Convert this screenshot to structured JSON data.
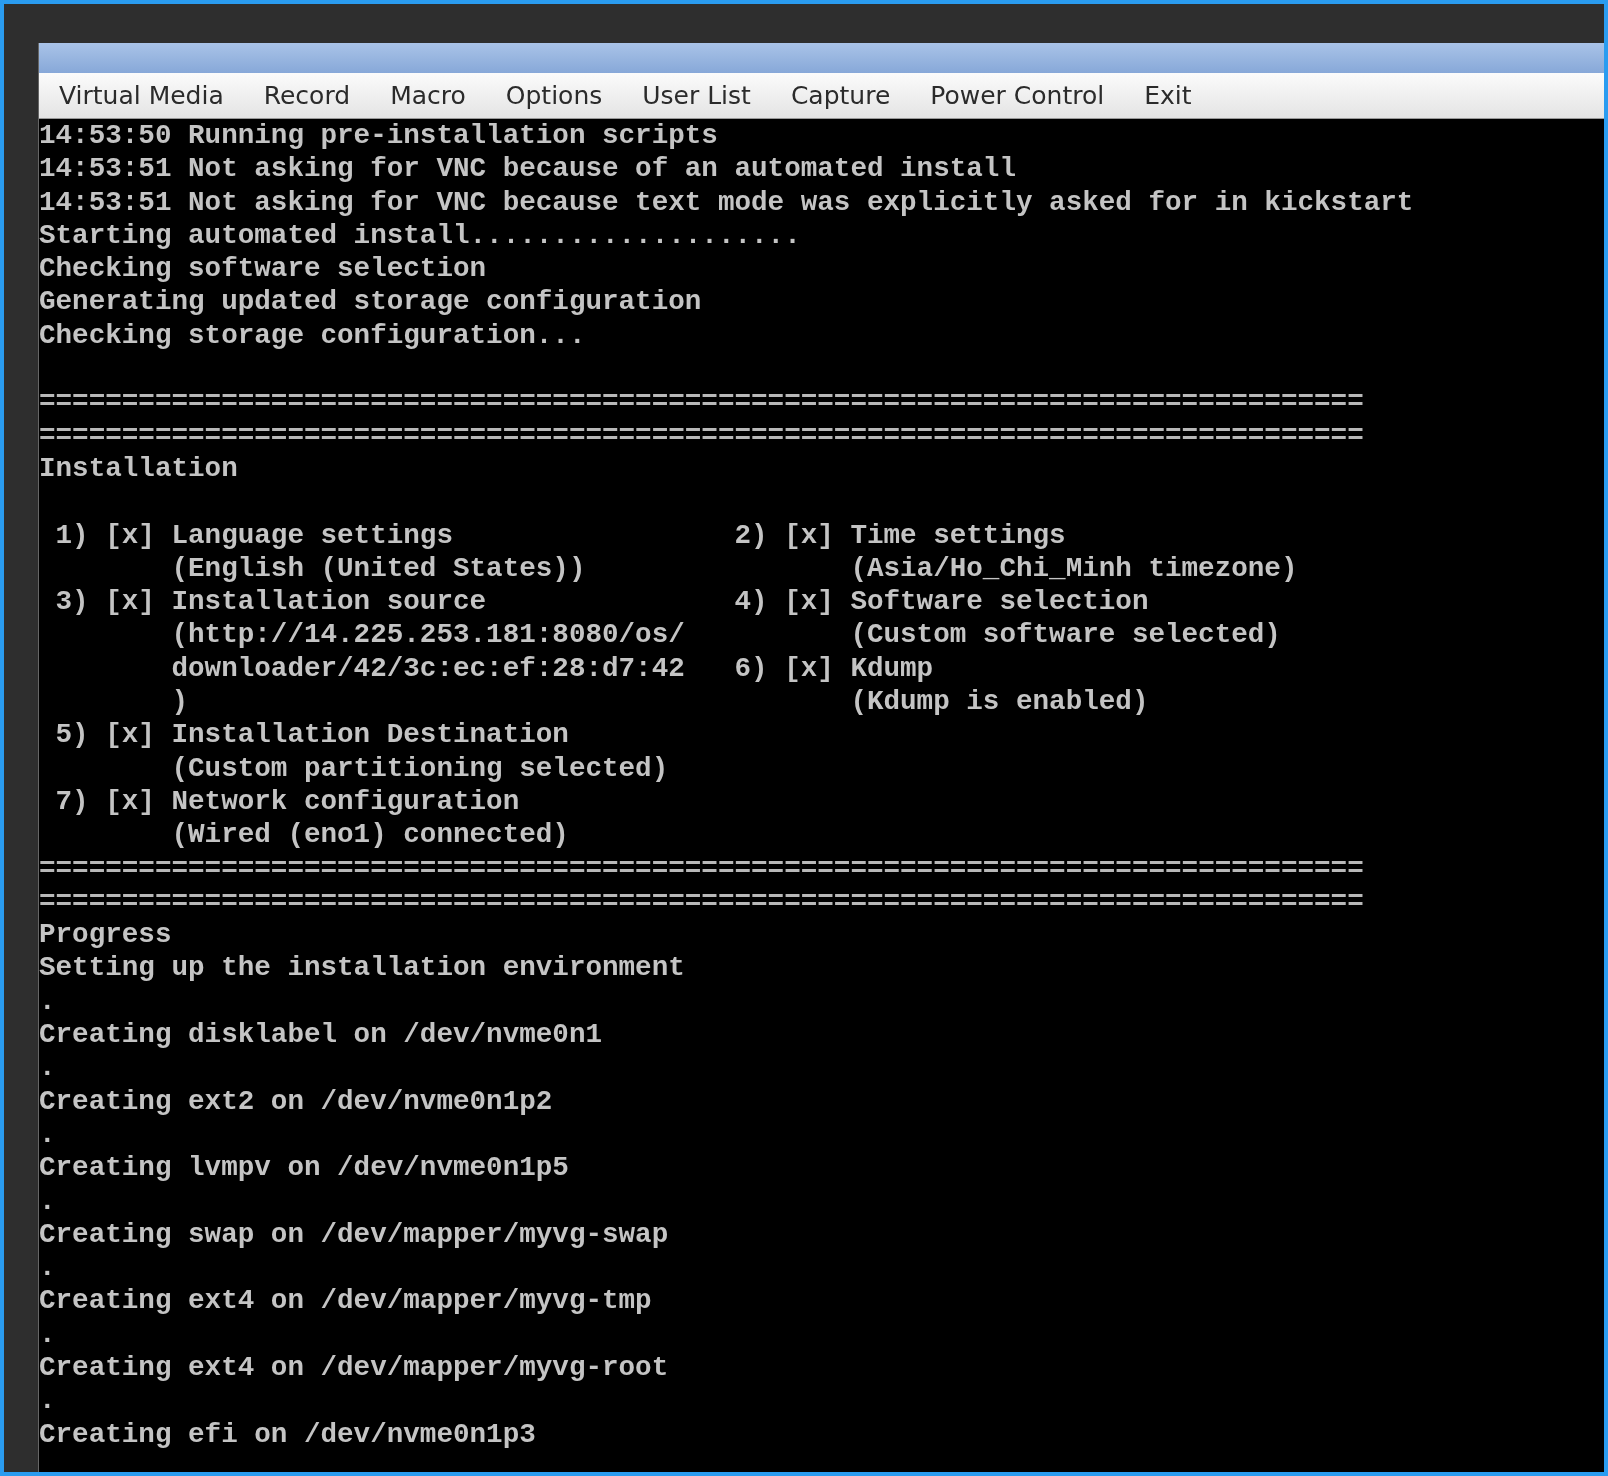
{
  "menu": [
    "Virtual Media",
    "Record",
    "Macro",
    "Options",
    "User List",
    "Capture",
    "Power Control",
    "Exit"
  ],
  "console": [
    {
      "kind": "text",
      "text": "14:53:50 Running pre-installation scripts"
    },
    {
      "kind": "text",
      "text": "14:53:51 Not asking for VNC because of an automated install"
    },
    {
      "kind": "text",
      "text": "14:53:51 Not asking for VNC because text mode was explicitly asked for in kickstart"
    },
    {
      "kind": "text",
      "text": "Starting automated install...................."
    },
    {
      "kind": "text",
      "text": "Checking software selection"
    },
    {
      "kind": "text",
      "text": "Generating updated storage configuration"
    },
    {
      "kind": "text",
      "text": "Checking storage configuration..."
    },
    {
      "kind": "blank"
    },
    {
      "kind": "separator",
      "text": "================================================================================"
    },
    {
      "kind": "separator",
      "text": "================================================================================"
    },
    {
      "kind": "text",
      "text": "Installation"
    },
    {
      "kind": "blank"
    },
    {
      "kind": "columns",
      "left": " 1) [x] Language settings",
      "right": "2) [x] Time settings"
    },
    {
      "kind": "columns",
      "left": "        (English (United States))",
      "right": "       (Asia/Ho_Chi_Minh timezone)"
    },
    {
      "kind": "columns",
      "left": " 3) [x] Installation source",
      "right": "4) [x] Software selection"
    },
    {
      "kind": "columns",
      "left": "        (http://14.225.253.181:8080/os/",
      "right": "       (Custom software selected)"
    },
    {
      "kind": "columns",
      "left": "        downloader/42/3c:ec:ef:28:d7:42",
      "right": "6) [x] Kdump"
    },
    {
      "kind": "columns",
      "left": "        )",
      "right": "       (Kdump is enabled)"
    },
    {
      "kind": "text",
      "text": " 5) [x] Installation Destination"
    },
    {
      "kind": "text",
      "text": "        (Custom partitioning selected)"
    },
    {
      "kind": "text",
      "text": " 7) [x] Network configuration"
    },
    {
      "kind": "text",
      "text": "        (Wired (eno1) connected)"
    },
    {
      "kind": "separator",
      "text": "================================================================================"
    },
    {
      "kind": "separator",
      "text": "================================================================================"
    },
    {
      "kind": "text",
      "text": "Progress"
    },
    {
      "kind": "text",
      "text": "Setting up the installation environment"
    },
    {
      "kind": "text",
      "text": "."
    },
    {
      "kind": "text",
      "text": "Creating disklabel on /dev/nvme0n1"
    },
    {
      "kind": "text",
      "text": "."
    },
    {
      "kind": "text",
      "text": "Creating ext2 on /dev/nvme0n1p2"
    },
    {
      "kind": "text",
      "text": "."
    },
    {
      "kind": "text",
      "text": "Creating lvmpv on /dev/nvme0n1p5"
    },
    {
      "kind": "text",
      "text": "."
    },
    {
      "kind": "text",
      "text": "Creating swap on /dev/mapper/myvg-swap"
    },
    {
      "kind": "text",
      "text": "."
    },
    {
      "kind": "text",
      "text": "Creating ext4 on /dev/mapper/myvg-tmp"
    },
    {
      "kind": "text",
      "text": "."
    },
    {
      "kind": "text",
      "text": "Creating ext4 on /dev/mapper/myvg-root"
    },
    {
      "kind": "text",
      "text": "."
    },
    {
      "kind": "text",
      "text": "Creating efi on /dev/nvme0n1p3"
    }
  ]
}
